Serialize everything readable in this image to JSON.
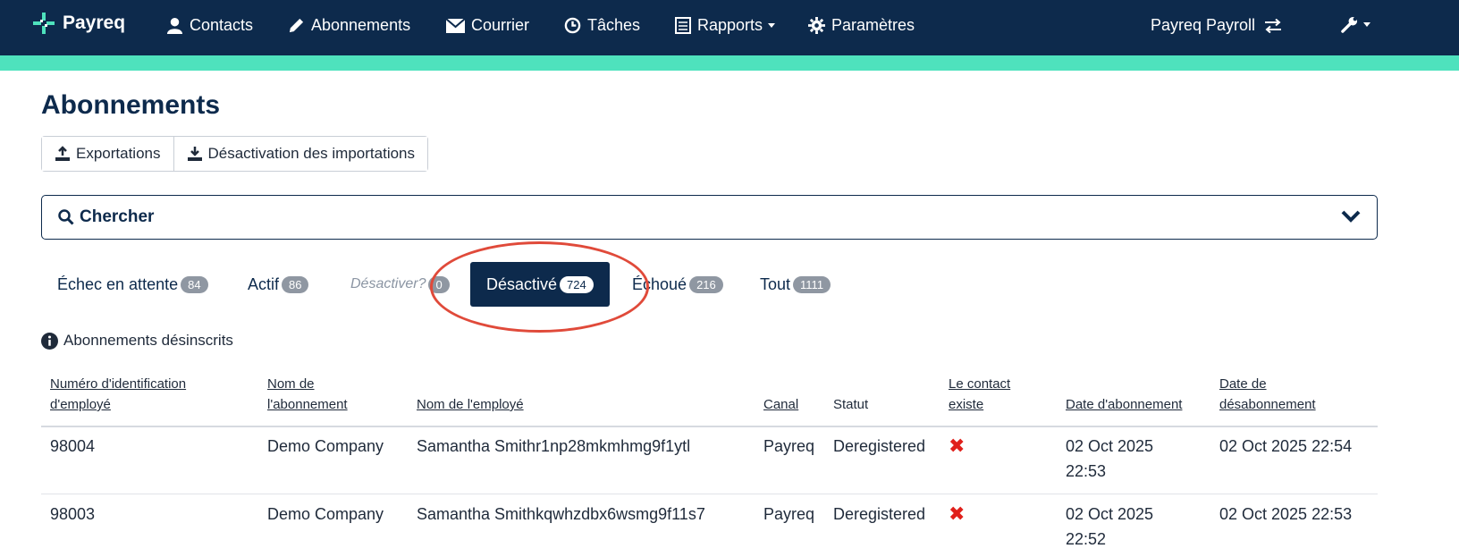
{
  "nav": {
    "brand": "Payreq",
    "items": [
      {
        "label": "Contacts",
        "icon": "user-icon"
      },
      {
        "label": "Abonnements",
        "icon": "pencil-icon"
      },
      {
        "label": "Courrier",
        "icon": "envelope-icon"
      },
      {
        "label": "Tâches",
        "icon": "clock-icon"
      },
      {
        "label": "Rapports",
        "icon": "report-icon"
      },
      {
        "label": "Paramètres",
        "icon": "gear-icon"
      }
    ],
    "account": "Payreq Payroll",
    "colors": {
      "navbar": "#0d2a4c",
      "accent": "#4ee2bd"
    }
  },
  "page": {
    "title": "Abonnements",
    "buttons": {
      "exports": "Exportations",
      "deactivation_imports": "Désactivation des importations"
    },
    "search_label": "Chercher"
  },
  "tabs": [
    {
      "label": "Échec en attente",
      "count": "84"
    },
    {
      "label": "Actif",
      "count": "86"
    },
    {
      "label": "Désactiver?",
      "count": "0"
    },
    {
      "label": "Désactivé",
      "count": "724",
      "active": true
    },
    {
      "label": "Échoué",
      "count": "216"
    },
    {
      "label": "Tout",
      "count": "1111"
    }
  ],
  "info": "Abonnements désinscrits",
  "table": {
    "headers": {
      "employee_id": [
        "Numéro d'identification",
        "d'employé"
      ],
      "subscription_name": [
        "Nom de",
        "l'abonnement"
      ],
      "employee_name": "Nom de l'employé",
      "channel": "Canal",
      "status": "Statut",
      "contact_exists": [
        "Le contact",
        "existe"
      ],
      "subscribe_date": "Date d'abonnement",
      "unsubscribe_date": [
        "Date de",
        "désabonnement"
      ]
    },
    "rows": [
      {
        "employee_id": "98004",
        "subscription_name": "Demo Company",
        "employee_name": "Samantha Smithr1np28mkmhmg9f1ytl",
        "channel": "Payreq",
        "status": "Deregistered",
        "contact_exists": "✖",
        "subscribe_date": [
          "02 Oct 2025",
          "22:53"
        ],
        "unsubscribe_date": "02 Oct 2025 22:54"
      },
      {
        "employee_id": "98003",
        "subscription_name": "Demo Company",
        "employee_name": "Samantha Smithkqwhzdbx6wsmg9f11s7",
        "channel": "Payreq",
        "status": "Deregistered",
        "contact_exists": "✖",
        "subscribe_date": [
          "02 Oct 2025",
          "22:52"
        ],
        "unsubscribe_date": "02 Oct 2025 22:53"
      }
    ]
  }
}
